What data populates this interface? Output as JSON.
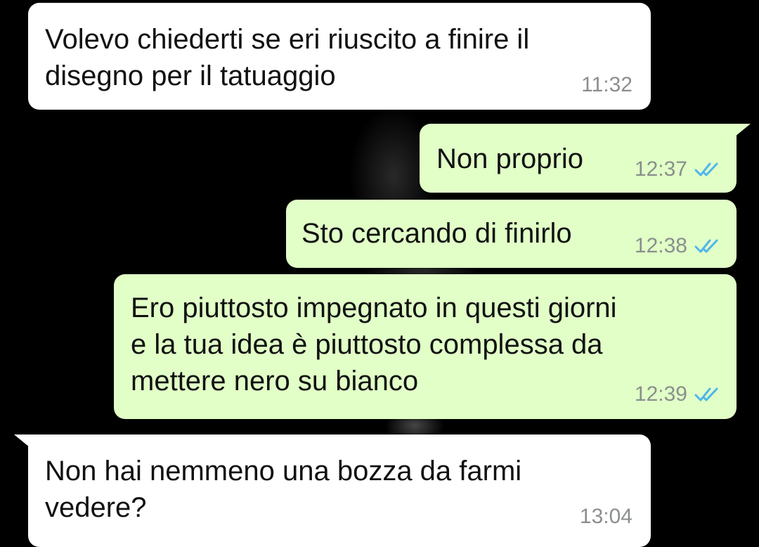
{
  "theme": {
    "incoming_bg": "#ffffff",
    "outgoing_bg": "#e1ffc7",
    "timestamp_color": "#8a8f8c",
    "read_tick_color": "#4fb6ec",
    "wallpaper": "#000000"
  },
  "messages": [
    {
      "direction": "incoming",
      "text": "Volevo chiederti se eri riuscito a finire il\ndisegno per il tatuaggio",
      "time": "11:32"
    },
    {
      "direction": "outgoing",
      "text": "Non proprio",
      "time": "12:37",
      "status_icon": "double-check-icon"
    },
    {
      "direction": "outgoing",
      "text": "Sto cercando di finirlo",
      "time": "12:38",
      "status_icon": "double-check-icon"
    },
    {
      "direction": "outgoing",
      "text": "Ero piuttosto impegnato in questi giorni\ne la tua idea è piuttosto complessa da\nmettere nero su bianco",
      "time": "12:39",
      "status_icon": "double-check-icon"
    },
    {
      "direction": "incoming",
      "text": "Non hai nemmeno una bozza da farmi\nvedere?",
      "time": "13:04"
    }
  ]
}
